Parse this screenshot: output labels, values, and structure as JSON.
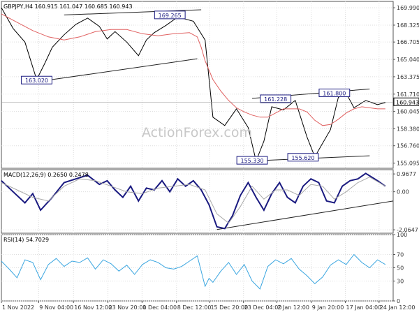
{
  "chart_data": [
    {
      "panel": "price",
      "type": "line",
      "title": "GBPJPY,H4",
      "header_values": [
        "160.915",
        "161.047",
        "160.685",
        "160.943"
      ],
      "y_ticks": [
        169.99,
        168.325,
        166.705,
        165.04,
        163.375,
        161.71,
        160.045,
        158.38,
        156.76,
        155.095
      ],
      "ylim": [
        154.6,
        170.6
      ],
      "x_range": [
        0,
        100
      ],
      "last_price": "160.943",
      "watermark": "ActionForex.com",
      "series": [
        {
          "color": "#000000",
          "x": [
            0,
            3,
            6,
            9,
            11,
            13,
            16,
            19,
            22,
            25,
            27,
            29,
            32,
            35,
            37,
            39,
            42,
            45,
            49,
            52,
            54,
            57,
            60,
            63,
            65,
            67,
            69,
            72,
            75,
            78,
            80,
            82,
            84,
            86,
            88,
            90,
            93,
            96,
            98
          ],
          "values": [
            170.0,
            168.0,
            166.7,
            163.1,
            164.6,
            166.2,
            167.4,
            168.4,
            169.0,
            168.2,
            167.0,
            167.7,
            166.7,
            165.4,
            166.9,
            167.6,
            168.3,
            169.1,
            168.7,
            166.9,
            159.5,
            158.7,
            160.3,
            158.5,
            155.3,
            157.2,
            160.5,
            160.2,
            161.1,
            157.6,
            155.7,
            157.0,
            158.3,
            161.4,
            161.8,
            160.4,
            161.1,
            160.7,
            160.9
          ]
        },
        {
          "color": "#e06060",
          "x": [
            0,
            4,
            8,
            12,
            16,
            20,
            24,
            28,
            32,
            36,
            40,
            44,
            48,
            50,
            51,
            52,
            54,
            56,
            58,
            60,
            62,
            64,
            66,
            68,
            70,
            72,
            74,
            76,
            78,
            80,
            82,
            84,
            86,
            88,
            90,
            92,
            94,
            96,
            98
          ],
          "values": [
            169.4,
            168.6,
            167.8,
            167.2,
            166.9,
            167.2,
            167.7,
            167.9,
            167.9,
            167.5,
            167.3,
            167.5,
            167.6,
            167.2,
            166.2,
            164.9,
            163.1,
            162.0,
            161.1,
            160.4,
            160.0,
            159.7,
            159.5,
            159.5,
            159.9,
            160.3,
            160.3,
            160.3,
            160.0,
            159.2,
            158.7,
            158.8,
            159.3,
            159.9,
            160.3,
            160.5,
            160.4,
            160.3,
            160.3
          ]
        }
      ],
      "trendlines": [
        {
          "x": [
            16,
            51
          ],
          "values": [
            169.3,
            169.8
          ]
        },
        {
          "x": [
            11,
            50
          ],
          "values": [
            163.0,
            165.1
          ]
        },
        {
          "x": [
            64,
            94
          ],
          "values": [
            161.3,
            162.2
          ]
        },
        {
          "x": [
            64,
            94
          ],
          "values": [
            155.3,
            155.8
          ]
        }
      ],
      "annotations": [
        {
          "text": "169.265",
          "x": 43,
          "y": 169.27
        },
        {
          "text": "163.020",
          "x": 9,
          "y": 163.02
        },
        {
          "text": "161.228",
          "x": 70,
          "y": 161.23
        },
        {
          "text": "161.800",
          "x": 85,
          "y": 161.8
        },
        {
          "text": "155.330",
          "x": 64,
          "y": 155.33
        },
        {
          "text": "155.620",
          "x": 77,
          "y": 155.62
        }
      ]
    },
    {
      "panel": "macd",
      "type": "line",
      "title": "MACD(12,26,9) 0.2650 0.2478",
      "y_ticks": [
        "0.9677",
        "0.00",
        "-2.0647"
      ],
      "y_tick_values": [
        0.9677,
        0.0,
        -2.0647
      ],
      "ylim": [
        -2.25,
        1.2
      ],
      "x_range": [
        0,
        100
      ],
      "series": [
        {
          "color": "#1a1a80",
          "x": [
            0,
            3,
            6,
            8,
            10,
            13,
            16,
            19,
            22,
            25,
            27,
            29,
            31,
            33,
            35,
            37,
            39,
            41,
            43,
            45,
            47,
            49,
            51,
            53,
            55,
            57,
            59,
            61,
            63,
            65,
            67,
            69,
            71,
            73,
            75,
            77,
            79,
            81,
            83,
            85,
            87,
            89,
            91,
            93,
            96,
            98
          ],
          "values": [
            0.6,
            0.0,
            -0.6,
            -0.1,
            -1.0,
            -0.3,
            0.5,
            0.7,
            0.9,
            0.4,
            0.6,
            0.1,
            -0.3,
            0.3,
            -0.5,
            0.2,
            0.1,
            0.6,
            0.0,
            0.7,
            0.3,
            0.6,
            0.1,
            -0.7,
            -1.9,
            -2.0,
            -1.3,
            -0.2,
            0.5,
            -0.3,
            -1.0,
            -0.1,
            0.5,
            -0.3,
            -0.6,
            0.3,
            0.7,
            0.5,
            -0.5,
            -0.6,
            0.3,
            0.6,
            0.7,
            1.0,
            0.6,
            0.3
          ]
        },
        {
          "color": "#aaaaaa",
          "x": [
            0,
            4,
            8,
            12,
            16,
            20,
            24,
            28,
            32,
            36,
            40,
            44,
            48,
            52,
            55,
            58,
            61,
            64,
            67,
            70,
            73,
            76,
            79,
            82,
            85,
            88,
            91,
            94,
            98
          ],
          "values": [
            0.5,
            0.1,
            -0.3,
            -0.5,
            0.3,
            0.7,
            0.6,
            0.3,
            0.0,
            -0.1,
            0.2,
            0.3,
            0.4,
            0.1,
            -1.2,
            -1.7,
            -0.8,
            0.3,
            -0.4,
            0.1,
            0.1,
            -0.2,
            0.4,
            0.3,
            -0.4,
            0.0,
            0.5,
            0.8,
            0.3
          ]
        }
      ],
      "trendlines": [
        {
          "x": [
            55,
            100
          ],
          "values": [
            -2.05,
            -0.5
          ]
        }
      ]
    },
    {
      "panel": "rsi",
      "type": "line",
      "title": "RSI(14) 54.7029",
      "y_ticks": [
        "100",
        "70",
        "50",
        "30",
        "0"
      ],
      "y_tick_values": [
        100,
        70,
        50,
        30,
        0
      ],
      "ylim": [
        0,
        100
      ],
      "x_range": [
        0,
        100
      ],
      "series": [
        {
          "color": "#3ba6e0",
          "x": [
            0,
            2,
            4,
            6,
            8,
            10,
            12,
            14,
            16,
            18,
            20,
            22,
            24,
            26,
            28,
            30,
            32,
            34,
            36,
            38,
            40,
            42,
            44,
            46,
            48,
            50,
            52,
            53,
            54,
            56,
            58,
            60,
            62,
            64,
            66,
            68,
            70,
            72,
            74,
            76,
            78,
            80,
            82,
            84,
            86,
            88,
            90,
            92,
            94,
            96,
            98
          ],
          "values": [
            60,
            48,
            35,
            62,
            58,
            32,
            55,
            64,
            52,
            60,
            58,
            65,
            48,
            62,
            56,
            45,
            54,
            40,
            55,
            62,
            58,
            50,
            48,
            52,
            60,
            68,
            22,
            34,
            28,
            45,
            58,
            40,
            55,
            30,
            18,
            52,
            62,
            56,
            64,
            48,
            38,
            26,
            36,
            54,
            62,
            55,
            70,
            58,
            50,
            62,
            55
          ]
        }
      ]
    }
  ],
  "x_axis": {
    "ticks": [
      {
        "label": "1 Nov 2022",
        "x": 0
      },
      {
        "label": "9 Nov 04:00",
        "x": 9.5
      },
      {
        "label": "16 Nov 12:00",
        "x": 18.4
      },
      {
        "label": "23 Nov 20:00",
        "x": 27.2
      },
      {
        "label": "1 Dec 04:00",
        "x": 35.9
      },
      {
        "label": "8 Dec 12:00",
        "x": 44.7
      },
      {
        "label": "15 Dec 20:00",
        "x": 53.2
      },
      {
        "label": "23 Dec 04:00",
        "x": 61.8
      },
      {
        "label": "2 Jan 12:00",
        "x": 70.3
      },
      {
        "label": "9 Jan 20:00",
        "x": 79.1
      },
      {
        "label": "17 Jan 04:00",
        "x": 87.8
      },
      {
        "label": "24 Jan 12:00",
        "x": 96.4
      }
    ]
  }
}
